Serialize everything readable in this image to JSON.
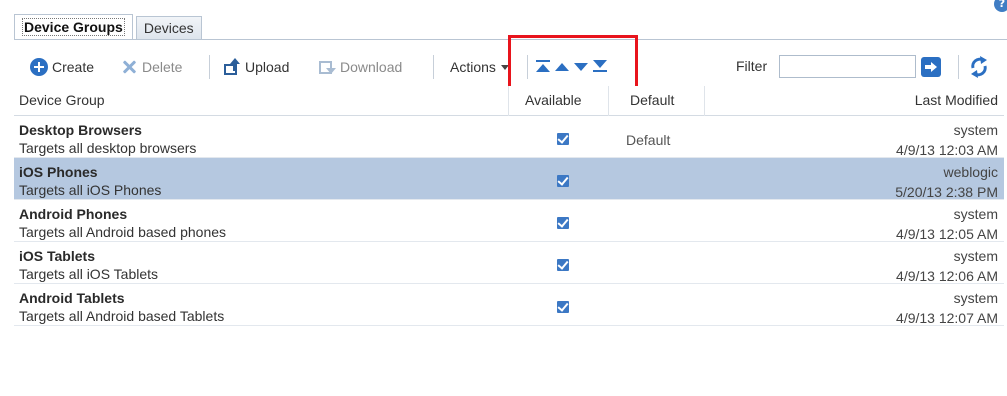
{
  "tabs": [
    {
      "label": "Device Groups",
      "active": true
    },
    {
      "label": "Devices",
      "active": false
    }
  ],
  "toolbar": {
    "create_label": "Create",
    "delete_label": "Delete",
    "upload_label": "Upload",
    "download_label": "Download",
    "actions_label": "Actions",
    "filter_label": "Filter",
    "filter_value": ""
  },
  "columns": {
    "group": "Device Group",
    "available": "Available",
    "default": "Default",
    "modified": "Last Modified"
  },
  "rows": [
    {
      "name": "Desktop Browsers",
      "description": "Targets all desktop browsers",
      "available": true,
      "default": "Default",
      "modified_by": "system",
      "modified_at": "4/9/13 12:03 AM",
      "selected": false
    },
    {
      "name": "iOS Phones",
      "description": "Targets all iOS Phones",
      "available": true,
      "default": "",
      "modified_by": "weblogic",
      "modified_at": "5/20/13 2:38 PM",
      "selected": true
    },
    {
      "name": "Android Phones",
      "description": "Targets all Android based phones",
      "available": true,
      "default": "",
      "modified_by": "system",
      "modified_at": "4/9/13 12:05 AM",
      "selected": false
    },
    {
      "name": "iOS Tablets",
      "description": "Targets all iOS Tablets",
      "available": true,
      "default": "",
      "modified_by": "system",
      "modified_at": "4/9/13 12:06 AM",
      "selected": false
    },
    {
      "name": "Android Tablets",
      "description": "Targets all Android based Tablets",
      "available": true,
      "default": "",
      "modified_by": "system",
      "modified_at": "4/9/13 12:07 AM",
      "selected": false
    }
  ],
  "colors": {
    "accent": "#2b6fc2",
    "selected_row": "#b5c8e0",
    "highlight_box": "#e8141c"
  },
  "icons": {
    "help": "help-icon",
    "create": "plus-circle-icon",
    "delete": "x-icon",
    "upload": "upload-icon",
    "download": "download-icon",
    "move_top": "move-to-top-icon",
    "move_up": "move-up-icon",
    "move_down": "move-down-icon",
    "move_bottom": "move-to-bottom-icon",
    "go": "go-arrow-icon",
    "refresh": "refresh-icon",
    "available": "checkbox-checked-icon"
  }
}
